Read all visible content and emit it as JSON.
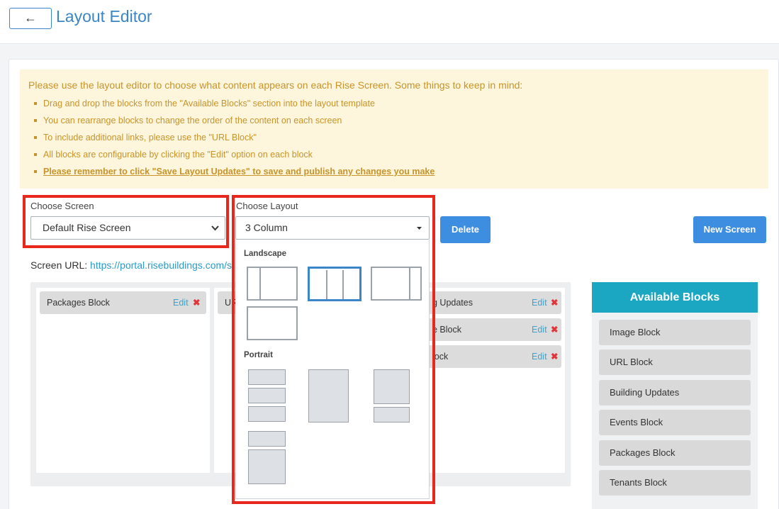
{
  "header": {
    "back_label": "←",
    "title": "Layout Editor"
  },
  "notice": {
    "intro": "Please use the layout editor to choose what content appears on each Rise Screen. Some things to keep in mind:",
    "items": [
      "Drag and drop the blocks from the \"Available Blocks\" section into the layout template",
      "You can rearrange blocks to change the order of the content on each screen",
      "To include additional links, please use the \"URL Block\"",
      "All blocks are configurable by clicking the \"Edit\" option on each block",
      "Please remember to click \"Save Layout Updates\" to save and publish any changes you make"
    ]
  },
  "choose_screen": {
    "label": "Choose Screen",
    "value": "Default Rise Screen"
  },
  "choose_layout": {
    "label": "Choose Layout",
    "value": "3 Column",
    "landscape_label": "Landscape",
    "portrait_label": "Portrait"
  },
  "buttons": {
    "delete": "Delete",
    "new_screen": "New Screen"
  },
  "screen_url": {
    "label": "Screen URL: ",
    "value": "https://portal.risebuildings.com/s"
  },
  "layout": {
    "edit_label": "Edit",
    "remove_icon": "✖",
    "col1": [
      "Packages Block"
    ],
    "col2_visible": "UR",
    "col3": [
      "g Updates",
      "e Block",
      "lock"
    ]
  },
  "available_blocks": {
    "title": "Available Blocks",
    "items": [
      "Image Block",
      "URL Block",
      "Building Updates",
      "Events Block",
      "Packages Block",
      "Tenants Block"
    ]
  },
  "colors": {
    "accent": "#3a86c8",
    "highlight": "#e8271d",
    "notice_text": "#c8932a",
    "available_header": "#1ba6c2"
  }
}
